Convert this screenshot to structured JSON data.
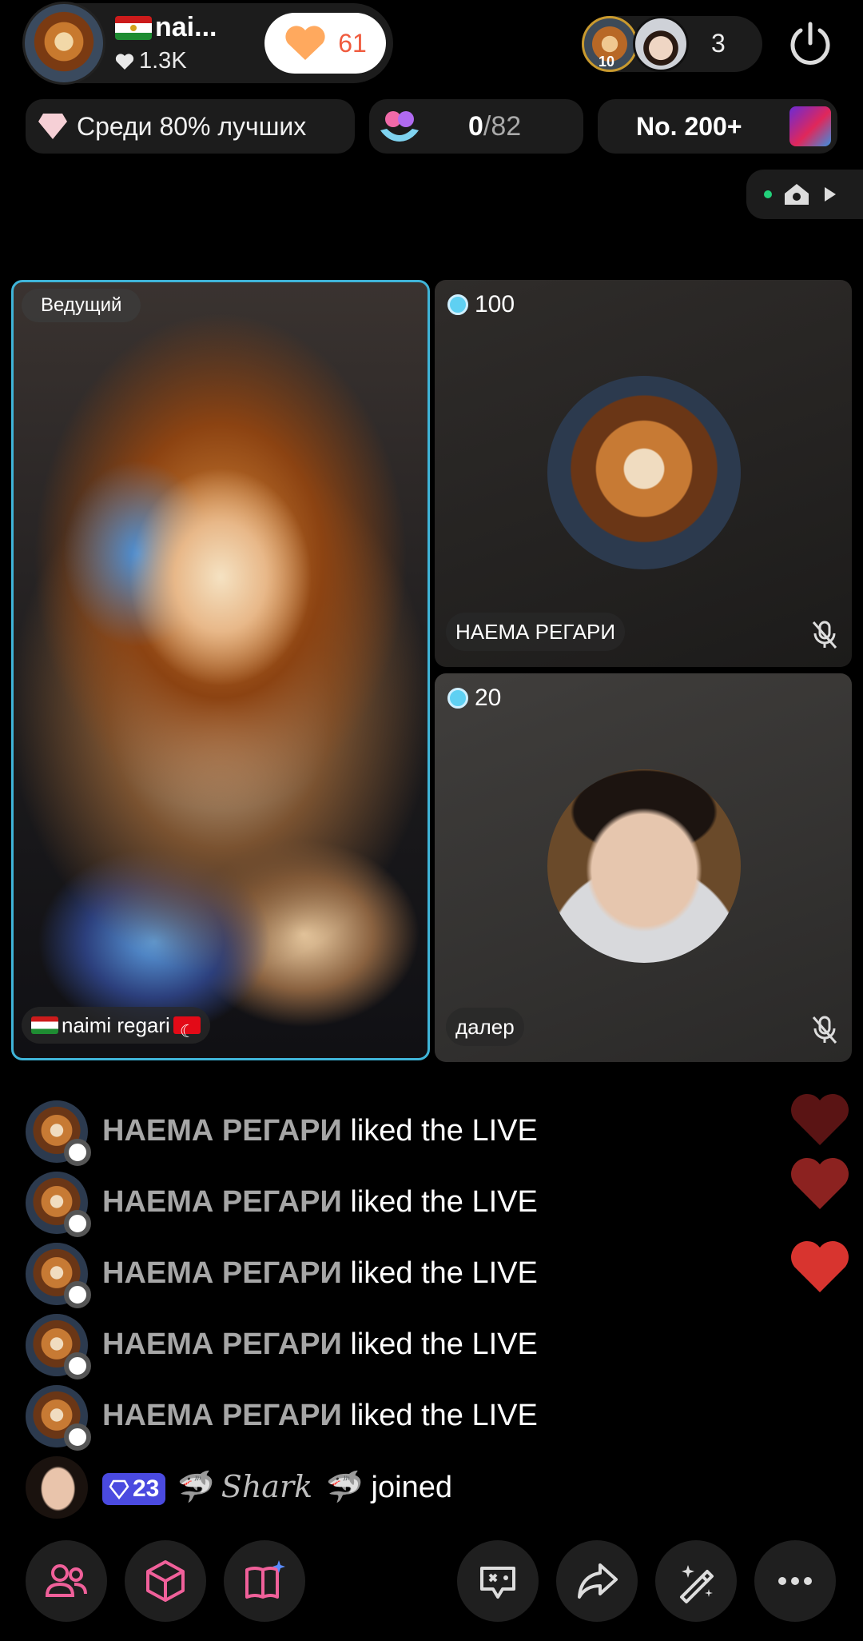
{
  "host": {
    "name": "nai...",
    "likes": "1.3K",
    "like_count": "61"
  },
  "viewers": {
    "badge_level": "10",
    "count": "3"
  },
  "stats": {
    "rank_text": "Среди 80% лучших",
    "gift_current": "0",
    "gift_total": "/82",
    "ranking": "No. 200+"
  },
  "tiles": {
    "host_tag": "Ведущий",
    "host_name": "naimi regari",
    "guest1_coins": "100",
    "guest1_name": "НАЕМА РЕГАРИ",
    "guest2_coins": "20",
    "guest2_name": "далер"
  },
  "chat": [
    {
      "user": "НАЕМА РЕГАРИ",
      "action": "liked the LIVE"
    },
    {
      "user": "НАЕМА РЕГАРИ",
      "action": "liked the LIVE"
    },
    {
      "user": "НАЕМА РЕГАРИ",
      "action": "liked the LIVE"
    },
    {
      "user": "НАЕМА РЕГАРИ",
      "action": "liked the LIVE"
    },
    {
      "user": "НАЕМА РЕГАРИ",
      "action": "liked the LIVE"
    }
  ],
  "join_event": {
    "level": "23",
    "user": "Shark",
    "action": "joined"
  },
  "colors": {
    "accent_blue": "#3fb4d8",
    "like_orange": "#f05b3e",
    "heart_red": "#d8342f",
    "level_badge": "#4a4ae0"
  },
  "toolbar": {
    "icons": [
      "people-icon",
      "cube-icon",
      "book-sparkle-icon",
      "game-icon",
      "share-icon",
      "magic-wand-icon",
      "more-icon"
    ]
  }
}
